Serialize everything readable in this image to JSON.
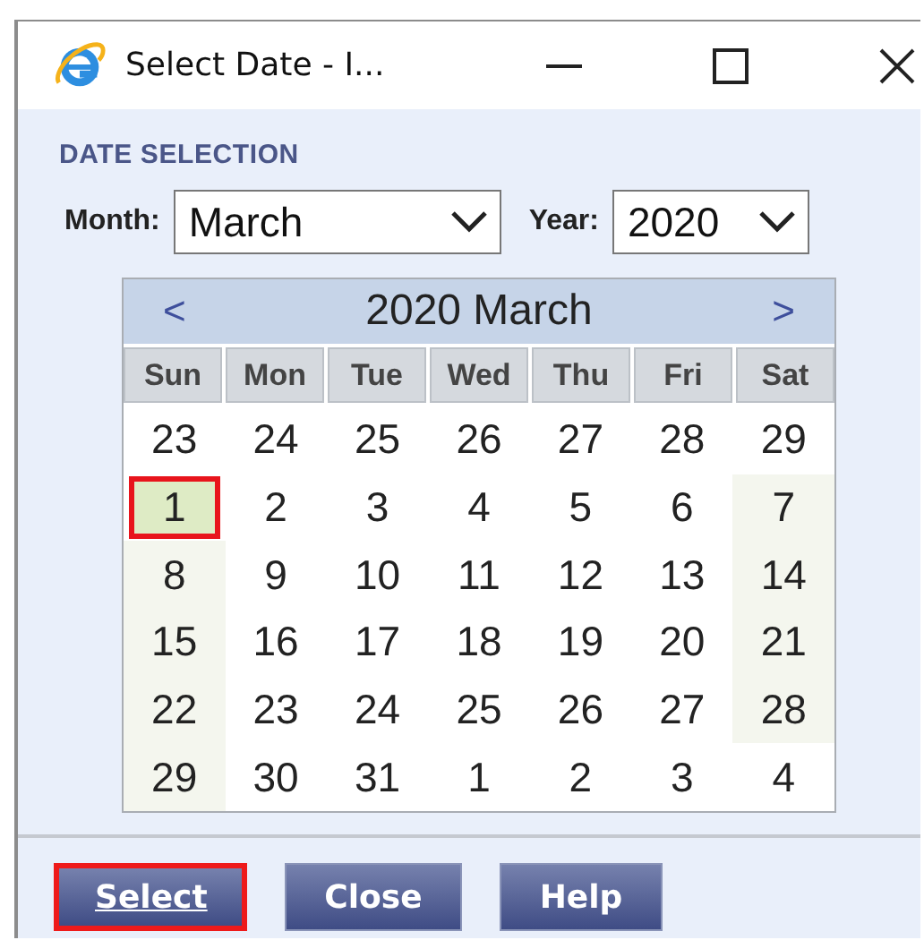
{
  "window": {
    "title": "Select Date - I..."
  },
  "section_title": "DATE SELECTION",
  "month": {
    "label": "Month:",
    "value": "March"
  },
  "year": {
    "label": "Year:",
    "value": "2020"
  },
  "calendar": {
    "prev": "<",
    "title": "2020 March",
    "next": ">",
    "weekdays": [
      "Sun",
      "Mon",
      "Tue",
      "Wed",
      "Thu",
      "Fri",
      "Sat"
    ],
    "weeks": [
      [
        {
          "day": "23",
          "shaded": false,
          "selected": false
        },
        {
          "day": "24",
          "shaded": false,
          "selected": false
        },
        {
          "day": "25",
          "shaded": false,
          "selected": false
        },
        {
          "day": "26",
          "shaded": false,
          "selected": false
        },
        {
          "day": "27",
          "shaded": false,
          "selected": false
        },
        {
          "day": "28",
          "shaded": false,
          "selected": false
        },
        {
          "day": "29",
          "shaded": false,
          "selected": false
        }
      ],
      [
        {
          "day": "1",
          "shaded": true,
          "selected": true
        },
        {
          "day": "2",
          "shaded": false,
          "selected": false
        },
        {
          "day": "3",
          "shaded": false,
          "selected": false
        },
        {
          "day": "4",
          "shaded": false,
          "selected": false
        },
        {
          "day": "5",
          "shaded": false,
          "selected": false
        },
        {
          "day": "6",
          "shaded": false,
          "selected": false
        },
        {
          "day": "7",
          "shaded": true,
          "selected": false
        }
      ],
      [
        {
          "day": "8",
          "shaded": true,
          "selected": false
        },
        {
          "day": "9",
          "shaded": false,
          "selected": false
        },
        {
          "day": "10",
          "shaded": false,
          "selected": false
        },
        {
          "day": "11",
          "shaded": false,
          "selected": false
        },
        {
          "day": "12",
          "shaded": false,
          "selected": false
        },
        {
          "day": "13",
          "shaded": false,
          "selected": false
        },
        {
          "day": "14",
          "shaded": true,
          "selected": false
        }
      ],
      [
        {
          "day": "15",
          "shaded": true,
          "selected": false
        },
        {
          "day": "16",
          "shaded": false,
          "selected": false
        },
        {
          "day": "17",
          "shaded": false,
          "selected": false
        },
        {
          "day": "18",
          "shaded": false,
          "selected": false
        },
        {
          "day": "19",
          "shaded": false,
          "selected": false
        },
        {
          "day": "20",
          "shaded": false,
          "selected": false
        },
        {
          "day": "21",
          "shaded": true,
          "selected": false
        }
      ],
      [
        {
          "day": "22",
          "shaded": true,
          "selected": false
        },
        {
          "day": "23",
          "shaded": false,
          "selected": false
        },
        {
          "day": "24",
          "shaded": false,
          "selected": false
        },
        {
          "day": "25",
          "shaded": false,
          "selected": false
        },
        {
          "day": "26",
          "shaded": false,
          "selected": false
        },
        {
          "day": "27",
          "shaded": false,
          "selected": false
        },
        {
          "day": "28",
          "shaded": true,
          "selected": false
        }
      ],
      [
        {
          "day": "29",
          "shaded": true,
          "selected": false
        },
        {
          "day": "30",
          "shaded": false,
          "selected": false
        },
        {
          "day": "31",
          "shaded": false,
          "selected": false
        },
        {
          "day": "1",
          "shaded": false,
          "selected": false
        },
        {
          "day": "2",
          "shaded": false,
          "selected": false
        },
        {
          "day": "3",
          "shaded": false,
          "selected": false
        },
        {
          "day": "4",
          "shaded": false,
          "selected": false
        }
      ]
    ]
  },
  "buttons": [
    {
      "label": "Select",
      "focused": true
    },
    {
      "label": "Close",
      "focused": false
    },
    {
      "label": "Help",
      "focused": false
    }
  ]
}
